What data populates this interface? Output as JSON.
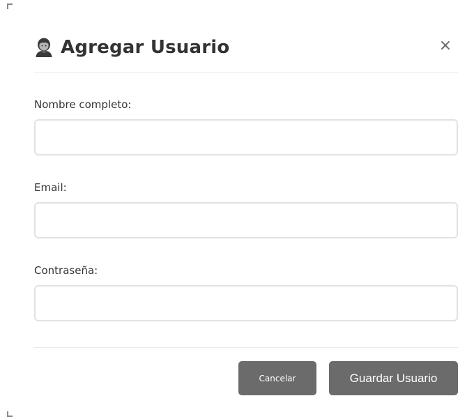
{
  "modal": {
    "title": "Agregar Usuario",
    "close_label": "×",
    "icon": "user-icon"
  },
  "form": {
    "name_label": "Nombre completo:",
    "name_value": "",
    "name_placeholder": "",
    "email_label": "Email:",
    "email_value": "",
    "email_placeholder": "",
    "password_label": "Contraseña:",
    "password_value": "",
    "password_placeholder": ""
  },
  "actions": {
    "cancel_label": "Cancelar",
    "save_label": "Guardar Usuario"
  },
  "colors": {
    "button_bg": "#6b6b6b",
    "input_border": "#e2e2e2",
    "divider": "#e9e9e9",
    "text": "#333333"
  }
}
